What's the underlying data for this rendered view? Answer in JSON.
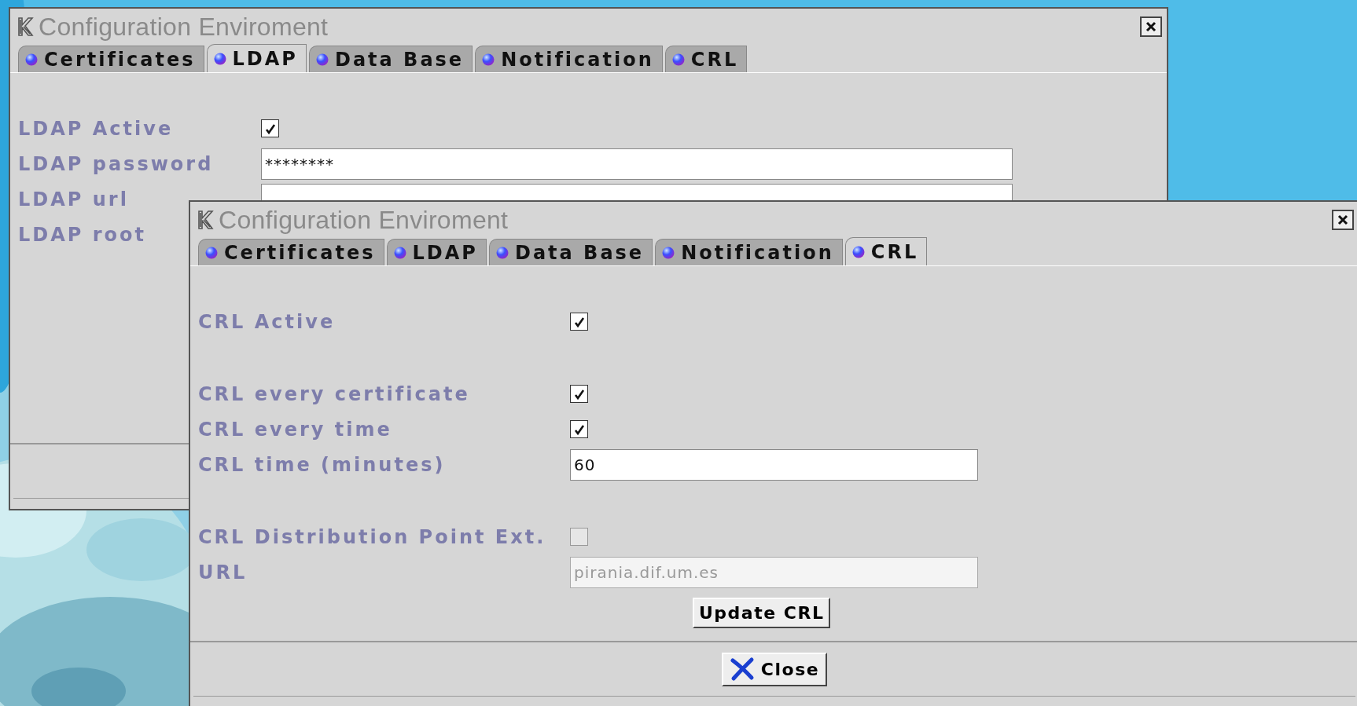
{
  "windows": [
    {
      "title": "Configuration Enviroment",
      "tabs": [
        {
          "label": "Certificates",
          "selected": false
        },
        {
          "label": "LDAP",
          "selected": true
        },
        {
          "label": "Data Base",
          "selected": false
        },
        {
          "label": "Notification",
          "selected": false
        },
        {
          "label": "CRL",
          "selected": false
        }
      ],
      "sections": [
        [
          {
            "kind": "checkbox",
            "label": "LDAP Active",
            "checked": true
          },
          {
            "kind": "password",
            "label": "LDAP password",
            "value": "********"
          },
          {
            "kind": "text",
            "label": "LDAP url"
          },
          {
            "kind": "label",
            "label": "LDAP root"
          }
        ]
      ]
    },
    {
      "title": "Configuration Enviroment",
      "tabs": [
        {
          "label": "Certificates",
          "selected": false
        },
        {
          "label": "LDAP",
          "selected": false
        },
        {
          "label": "Data Base",
          "selected": false
        },
        {
          "label": "Notification",
          "selected": false
        },
        {
          "label": "CRL",
          "selected": true
        }
      ],
      "sections": [
        [
          {
            "kind": "checkbox",
            "label": "CRL Active",
            "checked": true,
            "disabled": false
          }
        ],
        [
          {
            "kind": "checkbox",
            "label": "CRL every certificate",
            "checked": true,
            "disabled": false
          },
          {
            "kind": "checkbox",
            "label": "CRL every time",
            "checked": true,
            "disabled": false
          },
          {
            "kind": "text",
            "label": "CRL time (minutes)",
            "value": "60",
            "disabled": false
          }
        ],
        [
          {
            "kind": "checkbox",
            "label": "CRL Distribution Point Ext.",
            "checked": false,
            "disabled": true
          },
          {
            "kind": "text",
            "label": "URL",
            "value": "pirania.dif.um.es",
            "disabled": true
          }
        ]
      ],
      "action_button": "Update CRL",
      "footer_button": "Close"
    }
  ]
}
